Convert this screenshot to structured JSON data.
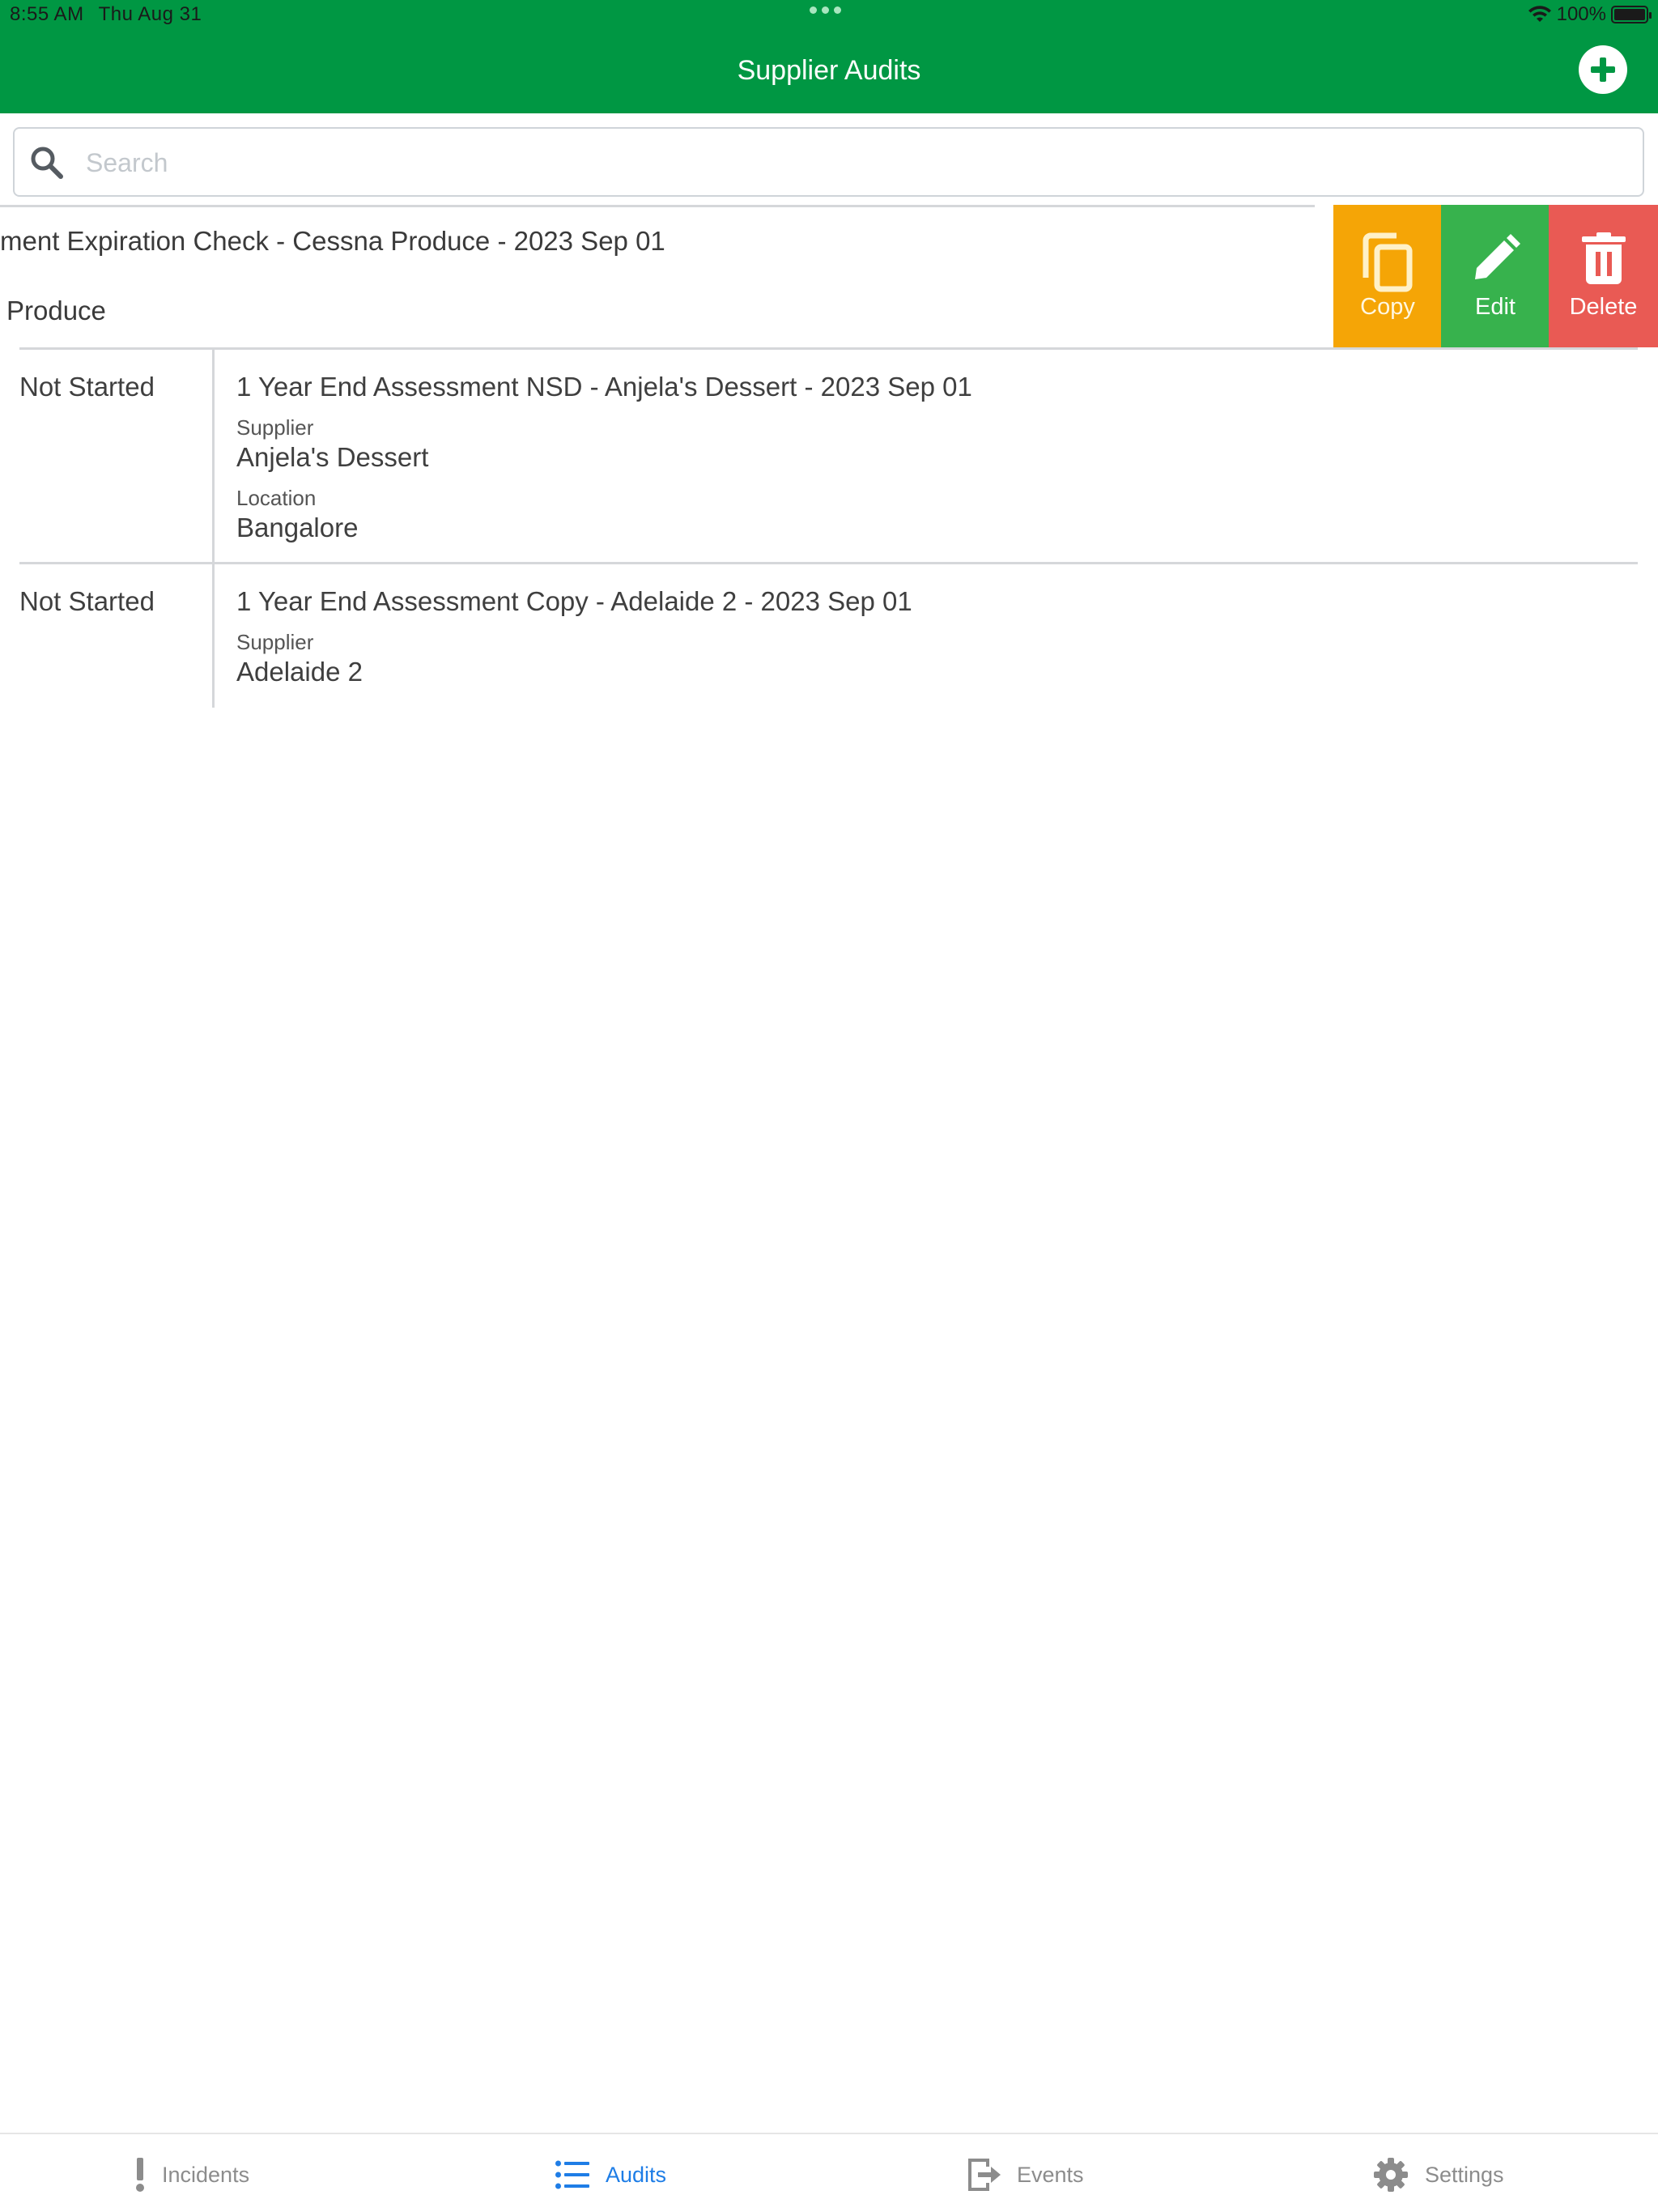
{
  "status_bar": {
    "time": "8:55 AM",
    "date": "Thu Aug 31",
    "battery": "100%"
  },
  "header": {
    "title": "Supplier Audits",
    "add_icon": "plus-circle-icon"
  },
  "search": {
    "placeholder": "Search",
    "value": ""
  },
  "swiped_row": {
    "title": "ment Expiration Check - Cessna Produce - 2023 Sep 01",
    "subtitle": "Produce",
    "actions": [
      {
        "label": "Copy",
        "icon": "copy-icon",
        "color": "#f5a506"
      },
      {
        "label": "Edit",
        "icon": "pencil-icon",
        "color": "#37b24d"
      },
      {
        "label": "Delete",
        "icon": "trash-icon",
        "color": "#e95a54"
      }
    ]
  },
  "audits": [
    {
      "status": "Not Started",
      "title": "1 Year End Assessment NSD - Anjela's Dessert - 2023 Sep 01",
      "supplier_label": "Supplier",
      "supplier": "Anjela's Dessert",
      "location_label": "Location",
      "location": "Bangalore"
    },
    {
      "status": "Not Started",
      "title": "1 Year End Assessment Copy - Adelaide 2 - 2023 Sep 01",
      "supplier_label": "Supplier",
      "supplier": "Adelaide 2"
    }
  ],
  "tabs": [
    {
      "label": "Incidents",
      "icon": "exclamation-icon",
      "active": false
    },
    {
      "label": "Audits",
      "icon": "list-icon",
      "active": true
    },
    {
      "label": "Events",
      "icon": "exit-icon",
      "active": false
    },
    {
      "label": "Settings",
      "icon": "gear-icon",
      "active": false
    }
  ],
  "colors": {
    "header": "#009743",
    "active_tab": "#1e7de6",
    "inactive_tab": "#8c8c8c"
  }
}
